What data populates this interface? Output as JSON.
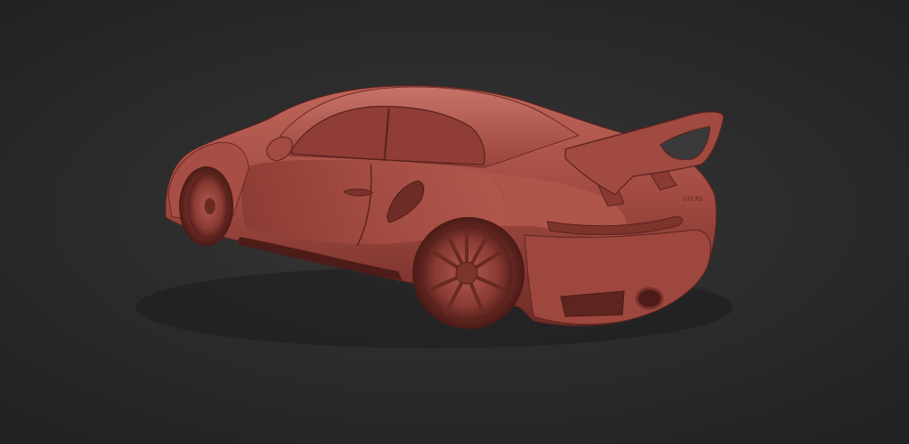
{
  "viewport": {
    "background_color": "#2b2b2b",
    "model_color": "#9c463e",
    "model_highlight": "#c46a5e",
    "model_shadow": "#5e2520"
  },
  "model": {
    "badge_text": "GT2 RS"
  }
}
